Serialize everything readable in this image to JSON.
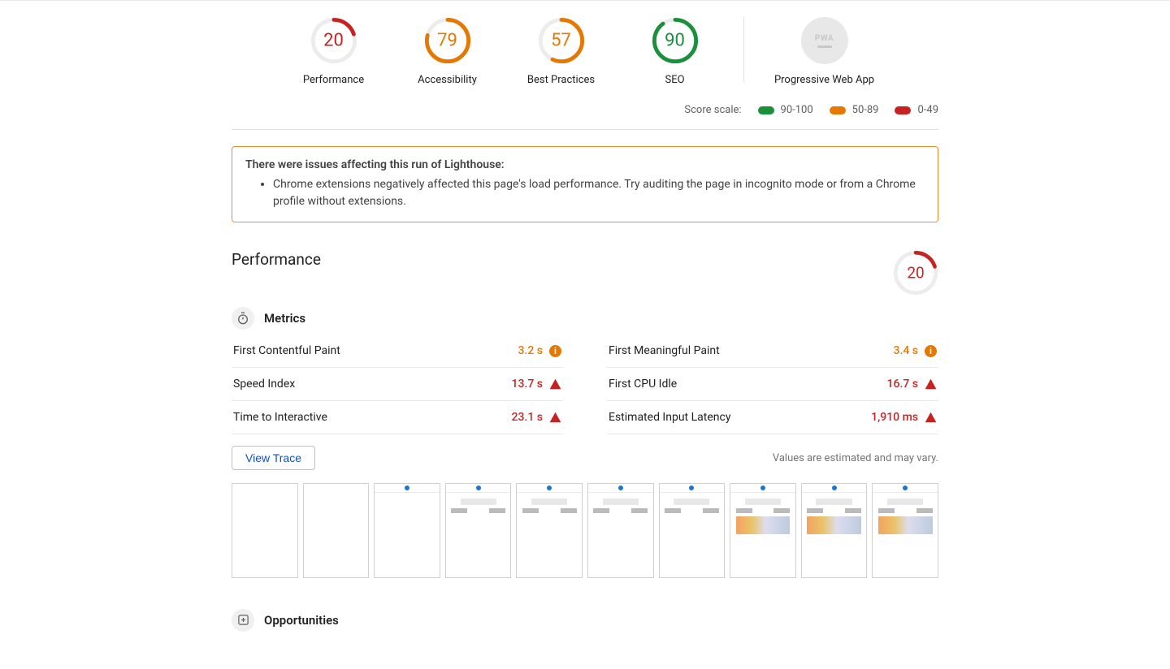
{
  "colors": {
    "red": "#c7221f",
    "orange": "#e67700",
    "green": "#1a8f3c",
    "grey": "#e8e8e8"
  },
  "scores": [
    {
      "value": 20,
      "label": "Performance",
      "color": "#c7221f",
      "pct": 20
    },
    {
      "value": 79,
      "label": "Accessibility",
      "color": "#e67700",
      "pct": 79
    },
    {
      "value": 57,
      "label": "Best Practices",
      "color": "#e67700",
      "pct": 57
    },
    {
      "value": 90,
      "label": "SEO",
      "color": "#1a8f3c",
      "pct": 90
    }
  ],
  "pwa_label": "Progressive Web App",
  "scale": {
    "label": "Score scale:",
    "items": [
      {
        "range": "90-100",
        "color": "#1a8f3c"
      },
      {
        "range": "50-89",
        "color": "#e67700"
      },
      {
        "range": "0-49",
        "color": "#c7221f"
      }
    ]
  },
  "warning": {
    "title": "There were issues affecting this run of Lighthouse:",
    "items": [
      "Chrome extensions negatively affected this page's load performance. Try auditing the page in incognito mode or from a Chrome profile without extensions."
    ]
  },
  "performance": {
    "title": "Performance",
    "gauge": {
      "value": 20,
      "color": "#c7221f",
      "pct": 20
    },
    "metrics_title": "Metrics",
    "metrics_left": [
      {
        "label": "First Contentful Paint",
        "value": "3.2 s",
        "color": "#e67700",
        "icon": "info"
      },
      {
        "label": "Speed Index",
        "value": "13.7 s",
        "color": "#c7221f",
        "icon": "warn"
      },
      {
        "label": "Time to Interactive",
        "value": "23.1 s",
        "color": "#c7221f",
        "icon": "warn"
      }
    ],
    "metrics_right": [
      {
        "label": "First Meaningful Paint",
        "value": "3.4 s",
        "color": "#e67700",
        "icon": "info"
      },
      {
        "label": "First CPU Idle",
        "value": "16.7 s",
        "color": "#c7221f",
        "icon": "warn"
      },
      {
        "label": "Estimated Input Latency",
        "value": "1,910 ms",
        "color": "#c7221f",
        "icon": "warn"
      }
    ],
    "view_trace": "View Trace",
    "estimate_note": "Values are estimated and may vary."
  },
  "opportunities_title": "Opportunities",
  "filmstrip_frames": 10
}
